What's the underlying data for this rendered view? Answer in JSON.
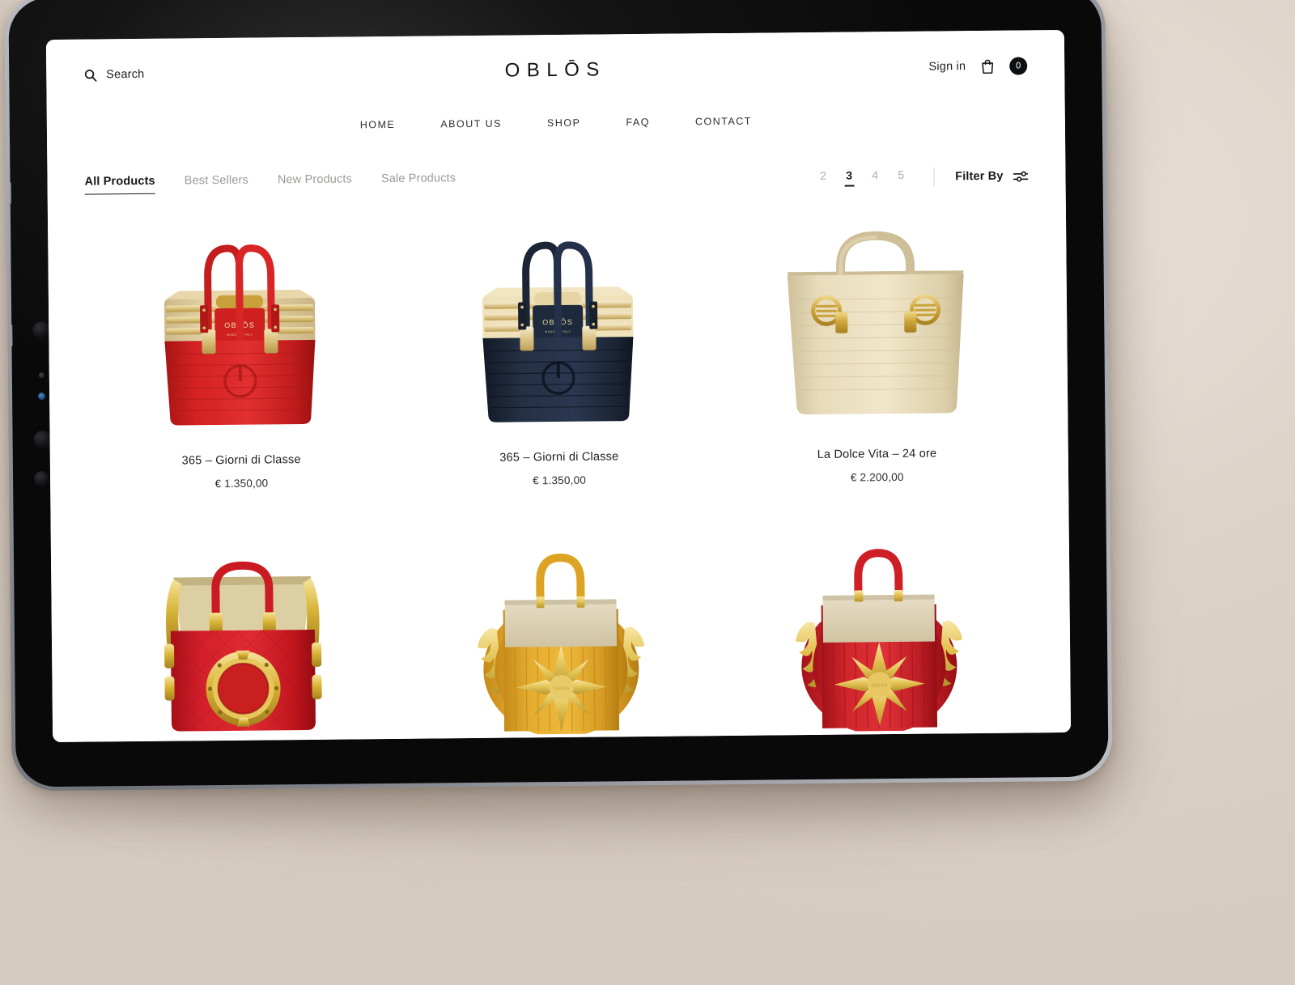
{
  "header": {
    "search_label": "Search",
    "search_icon": "search-icon",
    "brand": "OBLŌS",
    "signin_label": "Sign in",
    "bag_icon": "shopping-bag-icon",
    "cart_count": "0"
  },
  "nav": {
    "items": [
      {
        "label": "HOME"
      },
      {
        "label": "ABOUT US"
      },
      {
        "label": "SHOP"
      },
      {
        "label": "FAQ"
      },
      {
        "label": "CONTACT"
      }
    ]
  },
  "filterbar": {
    "tabs": [
      {
        "label": "All Products",
        "active": true
      },
      {
        "label": "Best Sellers",
        "active": false
      },
      {
        "label": "New Products",
        "active": false
      },
      {
        "label": "Sale Products",
        "active": false
      }
    ],
    "pagination": [
      {
        "label": "2",
        "active": false
      },
      {
        "label": "3",
        "active": true
      },
      {
        "label": "4",
        "active": false
      },
      {
        "label": "5",
        "active": false
      }
    ],
    "filter_by_label": "Filter By",
    "filter_icon": "sliders-icon"
  },
  "products": [
    {
      "name": "365 – Giorni di Classe",
      "price": "€ 1.350,00",
      "image_name": "red-tote-bag-image",
      "colors": {
        "body": "#cc1f1f",
        "body_dark": "#9c1212",
        "trim": "#e3d2a4",
        "gold": "#d8bd72"
      },
      "logo": "OBLŌS"
    },
    {
      "name": "365 – Giorni di Classe",
      "price": "€ 1.350,00",
      "image_name": "navy-tote-bag-image",
      "colors": {
        "body": "#1d2738",
        "body_dark": "#121a27",
        "trim": "#efdda8",
        "gold": "#d7bd74"
      },
      "logo": "OBLŌS"
    },
    {
      "name": "La Dolce Vita – 24 ore",
      "price": "€ 2.200,00",
      "image_name": "cream-tote-bag-image",
      "colors": {
        "body": "#e3d7b7",
        "body_dark": "#cfc19d",
        "trim": "#efe6cc",
        "gold": "#c9a84e"
      },
      "logo": ""
    },
    {
      "name": "",
      "price": "",
      "image_name": "red-quilted-porthole-bag-image",
      "colors": {
        "body": "#cf1a22",
        "body_dark": "#a01018",
        "trim": "#ded0a5",
        "gold": "#d8b437"
      },
      "logo": ""
    },
    {
      "name": "",
      "price": "",
      "image_name": "yellow-star-bag-image",
      "colors": {
        "body": "#e0a52a",
        "body_dark": "#c28a19",
        "trim": "#ded5bb",
        "gold": "#e9c85c"
      },
      "logo": ""
    },
    {
      "name": "",
      "price": "",
      "image_name": "red-star-bag-image",
      "colors": {
        "body": "#d2262b",
        "body_dark": "#a3161c",
        "trim": "#e0d6bb",
        "gold": "#e3c151"
      },
      "logo": ""
    }
  ]
}
